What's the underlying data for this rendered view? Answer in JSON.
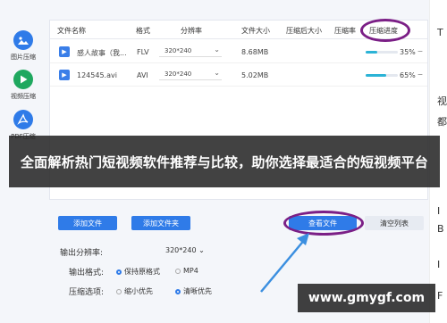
{
  "sidebar": {
    "items": [
      {
        "label": "图片压缩",
        "icon": "image-icon"
      },
      {
        "label": "视频压缩",
        "icon": "play-icon"
      },
      {
        "label": "PDF压缩",
        "icon": "pdf-icon"
      }
    ]
  },
  "table": {
    "headers": [
      "文件名称",
      "格式",
      "分辨率",
      "文件大小",
      "压缩后大小",
      "压缩率",
      "压缩进度"
    ],
    "rows": [
      {
        "name": "感人故事（我...",
        "format": "FLV",
        "resolution": "320*240",
        "size": "8.68MB",
        "progress": "35%",
        "progress_value": 0.35
      },
      {
        "name": "124545.avi",
        "format": "AVI",
        "resolution": "320*240",
        "size": "5.02MB",
        "progress": "65%",
        "progress_value": 0.65
      }
    ]
  },
  "banner": {
    "text": "全面解析热门短视频软件推荐与比较，助你选择最适合的短视频平台"
  },
  "buttons": {
    "add_file": "添加文件",
    "add_folder": "添加文件夹",
    "view_files": "查看文件",
    "clear_list": "清空列表"
  },
  "options": {
    "resolution_label": "输出分辨率:",
    "resolution_value": "320*240",
    "format_label": "输出格式:",
    "format_options": [
      "保持原格式",
      "MP4"
    ],
    "mode_label": "压缩选项:",
    "mode_options": [
      "缩小优先",
      "清晰优先"
    ]
  },
  "watermark": {
    "text": "www.gmygf.com"
  },
  "right_strip": {
    "chars": [
      "T",
      "视",
      "都",
      "I",
      "B",
      "I",
      "F"
    ]
  },
  "colors": {
    "accent": "#2f7be8",
    "highlight": "#7b1f86",
    "progress": "#2bb3d6"
  }
}
